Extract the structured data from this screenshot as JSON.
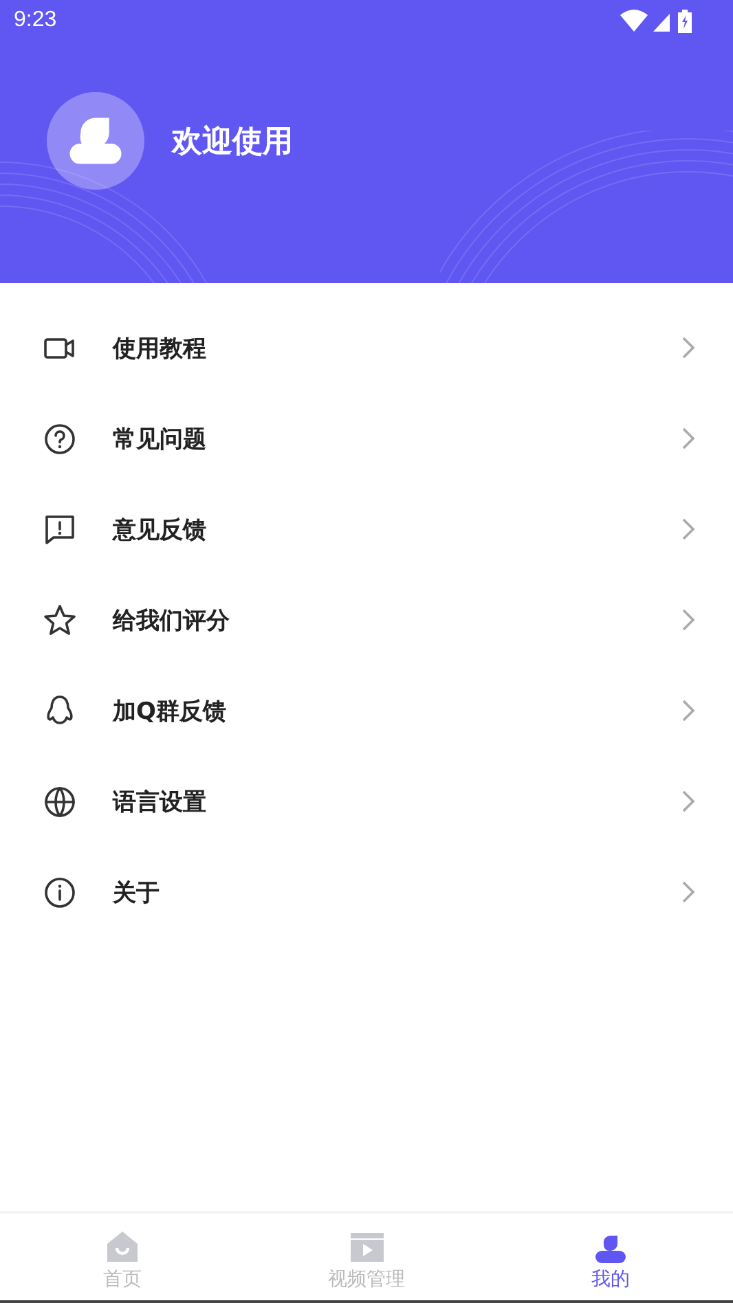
{
  "status_bar": {
    "time": "9:23"
  },
  "profile": {
    "greeting": "欢迎使用"
  },
  "menu": [
    {
      "kind": "video",
      "label": "使用教程"
    },
    {
      "kind": "question",
      "label": "常见问题"
    },
    {
      "kind": "feedback",
      "label": "意见反馈"
    },
    {
      "kind": "star",
      "label": "给我们评分"
    },
    {
      "kind": "qq",
      "label": "加Q群反馈"
    },
    {
      "kind": "globe",
      "label": "语言设置"
    },
    {
      "kind": "info",
      "label": "关于"
    }
  ],
  "bottom_nav": [
    {
      "kind": "home",
      "label": "首页",
      "selected": false
    },
    {
      "kind": "clapper",
      "label": "视频管理",
      "selected": false
    },
    {
      "kind": "person",
      "label": "我的",
      "selected": true
    }
  ]
}
